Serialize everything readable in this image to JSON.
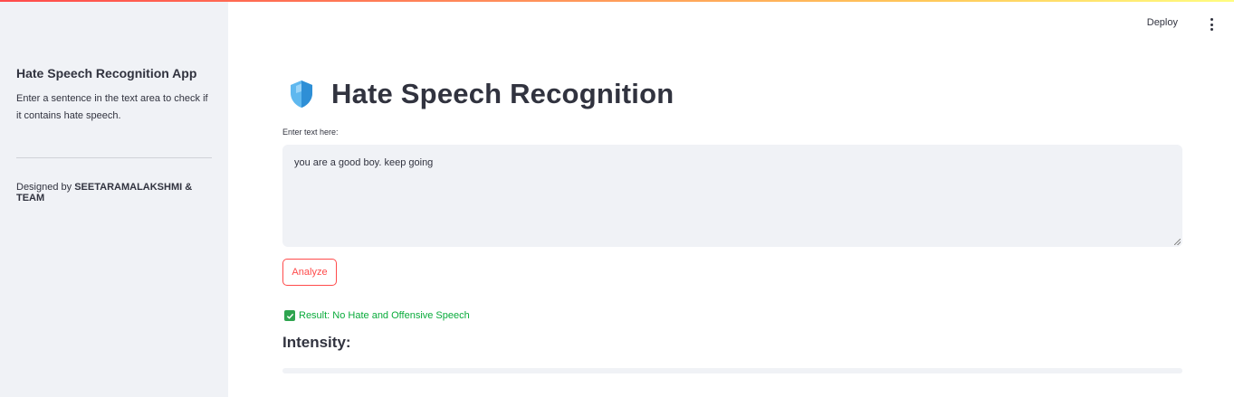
{
  "sidebar": {
    "title": "Hate Speech Recognition App",
    "description": "Enter a sentence in the text area to check if it contains hate speech.",
    "designed_prefix": "Designed by ",
    "designed_by": "SEETARAMALAKSHMI & TEAM"
  },
  "header": {
    "deploy_label": "Deploy",
    "menu_icon": "kebab-menu-icon"
  },
  "main": {
    "title_icon": "shield-icon",
    "title": "Hate Speech Recognition",
    "input_label": "Enter text here:",
    "input_value": "you are  a good boy. keep going",
    "analyze_label": "Analyze",
    "result_icon": "check-box-icon",
    "result_text": "Result: No Hate and Offensive Speech",
    "intensity_label": "Intensity:",
    "intensity_value": 0
  },
  "colors": {
    "accent": "#ff4b4b",
    "success": "#09ab3b",
    "sidebar_bg": "#f0f2f6",
    "text": "#31333f"
  }
}
